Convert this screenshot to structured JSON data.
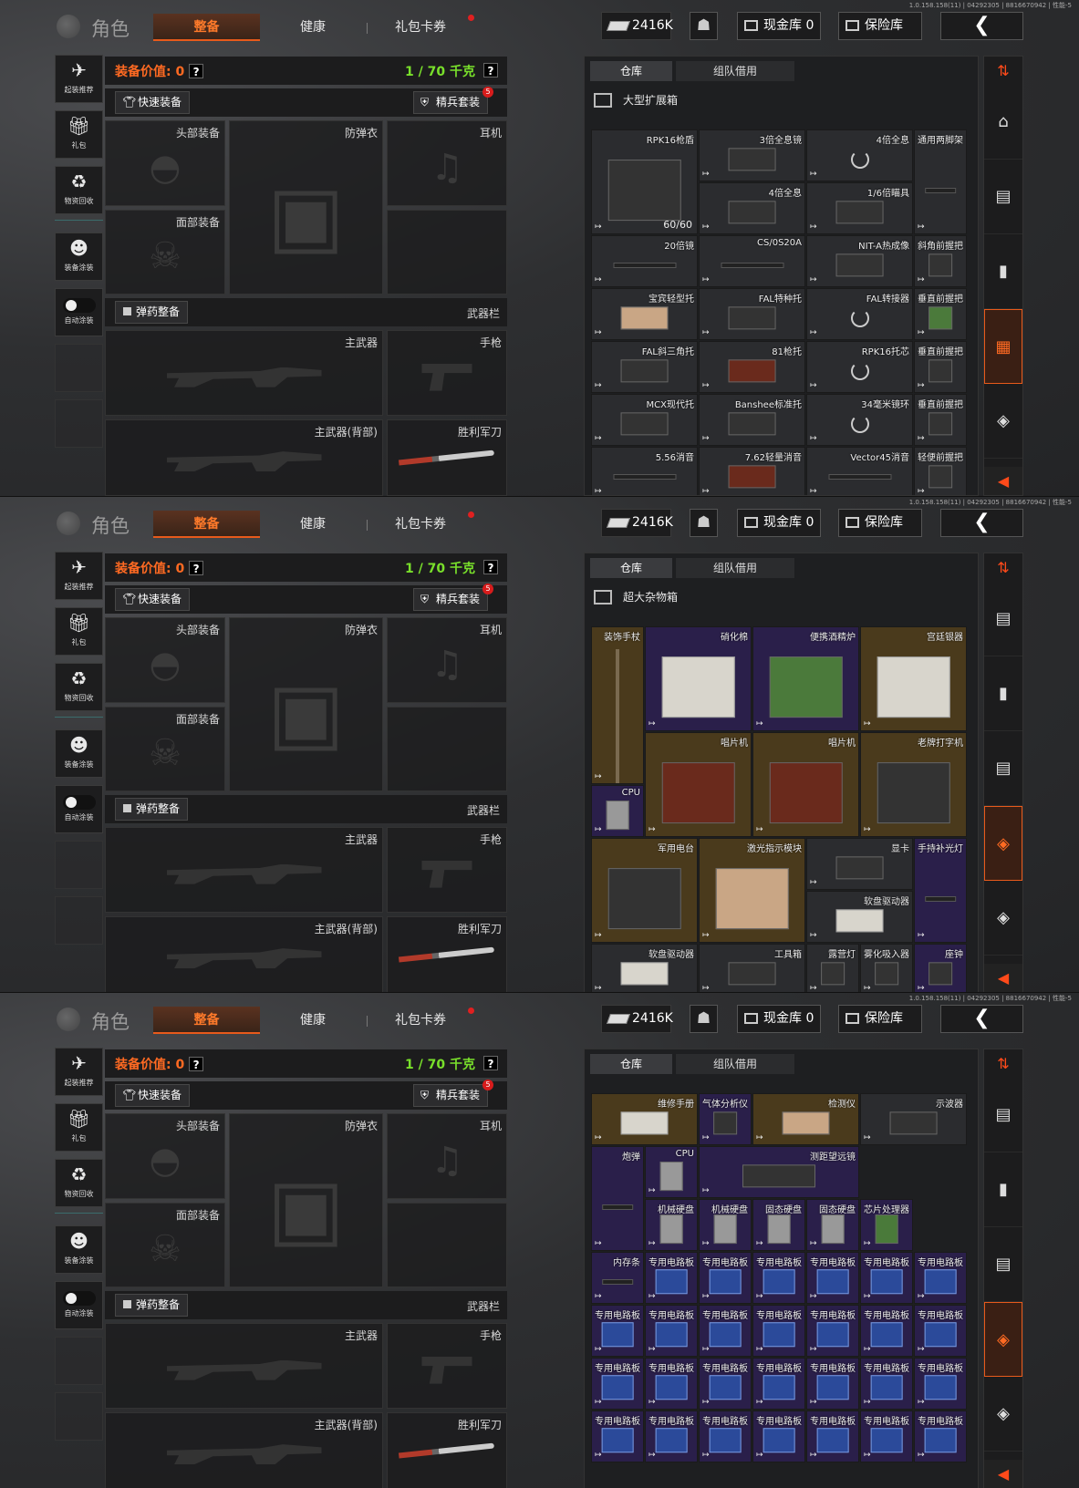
{
  "build": "1.0.158.158(11) | 04292305 | 8816670942 | 性能-5",
  "topbar": {
    "role_title": "角色",
    "tabs": [
      "整备",
      "健康",
      "礼包卡券"
    ],
    "money": "2416K",
    "cash_vault": "现金库 0",
    "safe": "保险库",
    "back_icon": "❮"
  },
  "left_sidebar": [
    "起装推荐",
    "礼包",
    "物资回收",
    "装备涂装",
    "自动涂装"
  ],
  "equip": {
    "value_label": "装备价值: 0",
    "help": "?",
    "weight": "1 / 70 千克",
    "quick_equip": "快速装备",
    "elite_kit": "精兵套装",
    "elite_badge": "5",
    "slots": {
      "head": "头部装备",
      "armor": "防弹衣",
      "ear": "耳机",
      "face": "面部装备",
      "ammo": "弹药整备",
      "weapons": "武器栏",
      "primary": "主武器",
      "pistol": "手枪",
      "primary_back": "主武器(背部)",
      "knife": "胜利军刀"
    }
  },
  "inventory": {
    "tabs": [
      "仓库",
      "组队借用"
    ],
    "screen1": {
      "box_title": "大型扩展箱",
      "items": [
        {
          "n": "RPK16枪盾",
          "cnt": "60/60"
        },
        {
          "n": "3倍全息镜"
        },
        {
          "n": "4倍全息"
        },
        {
          "n": "通用两脚架"
        },
        {
          "n": "4倍全息"
        },
        {
          "n": "1/6倍瞄具"
        },
        {
          "n": "20倍镜"
        },
        {
          "n": "CS/0S20A"
        },
        {
          "n": "NIT-A热成像"
        },
        {
          "n": "斜角前握把"
        },
        {
          "n": "宝宾轻型托"
        },
        {
          "n": "FAL特种托"
        },
        {
          "n": "FAL转接器"
        },
        {
          "n": "垂直前握把"
        },
        {
          "n": "FAL斜三角托"
        },
        {
          "n": "81枪托"
        },
        {
          "n": "RPK16托芯"
        },
        {
          "n": "垂直前握把"
        },
        {
          "n": "MCX现代托"
        },
        {
          "n": "Banshee标准托"
        },
        {
          "n": "34毫米镜环"
        },
        {
          "n": "垂直前握把"
        },
        {
          "n": "5.56消音"
        },
        {
          "n": "7.62轻量消音"
        },
        {
          "n": "Vector45消音"
        },
        {
          "n": "轻便前握把"
        }
      ]
    },
    "screen2": {
      "box_title": "超大杂物箱",
      "items": [
        {
          "n": "装饰手杖"
        },
        {
          "n": "硝化棉"
        },
        {
          "n": "便携酒精炉"
        },
        {
          "n": "宫廷银器"
        },
        {
          "n": "唱片机"
        },
        {
          "n": "唱片机"
        },
        {
          "n": "老牌打字机"
        },
        {
          "n": "CPU"
        },
        {
          "n": "军用电台"
        },
        {
          "n": "激光指示模块"
        },
        {
          "n": "显卡"
        },
        {
          "n": "手持补光灯"
        },
        {
          "n": "软盘驱动器"
        },
        {
          "n": "软盘驱动器"
        },
        {
          "n": "工具箱"
        },
        {
          "n": "露营灯"
        },
        {
          "n": "雾化吸入器"
        },
        {
          "n": "座钟"
        }
      ]
    },
    "screen3": {
      "items": [
        {
          "n": "维修手册"
        },
        {
          "n": "气体分析仪"
        },
        {
          "n": "检测仪"
        },
        {
          "n": "示波器"
        },
        {
          "n": "炮弹"
        },
        {
          "n": "CPU"
        },
        {
          "n": "测距望远镜"
        },
        {
          "n": "机械硬盘"
        },
        {
          "n": "机械硬盘"
        },
        {
          "n": "固态硬盘"
        },
        {
          "n": "固态硬盘"
        },
        {
          "n": "芯片处理器"
        },
        {
          "n": "内存条"
        },
        {
          "n": "专用电路板"
        }
      ]
    }
  },
  "colors": {
    "accent": "#e85a1b",
    "value": "#ff6a22",
    "weight": "#79e02b",
    "purple": "#2a1f4a",
    "brown": "#4a3a1c"
  }
}
